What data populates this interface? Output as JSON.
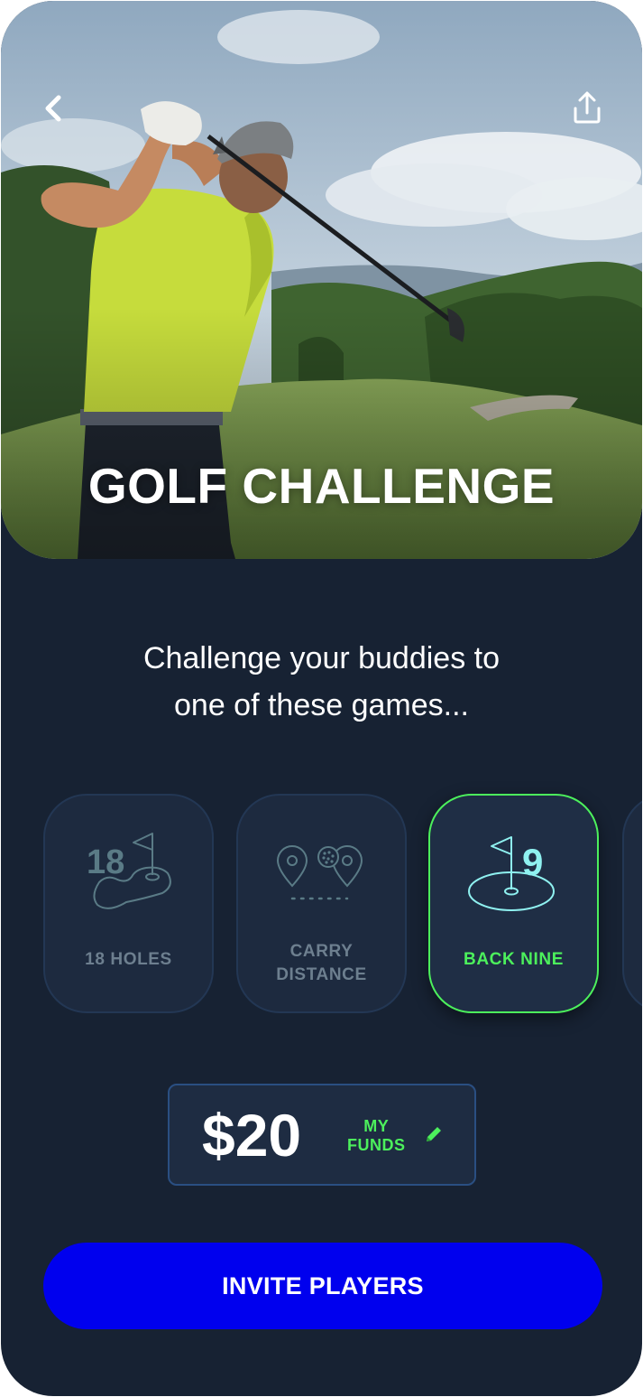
{
  "hero": {
    "title": "GOLF CHALLENGE",
    "back_icon": "chevron-left-icon",
    "share_icon": "share-upload-icon"
  },
  "intro": {
    "line1": "Challenge your buddies to",
    "line2": "one of these games..."
  },
  "games": [
    {
      "icon": "eighteen-holes-icon",
      "icon_text": "18",
      "label": "18 HOLES",
      "selected": false
    },
    {
      "icon": "carry-distance-icon",
      "label_line1": "CARRY",
      "label_line2": "DISTANCE",
      "selected": false
    },
    {
      "icon": "back-nine-icon",
      "icon_text": "9",
      "label": "BACK NINE",
      "selected": true
    }
  ],
  "funds": {
    "amount": "$20",
    "label_line1": "MY",
    "label_line2": "FUNDS",
    "edit_icon": "pencil-icon"
  },
  "cta": {
    "label": "INVITE PLAYERS"
  },
  "colors": {
    "background": "#172233",
    "card": "#1d2a3f",
    "accent_green": "#4cf05c",
    "primary_blue": "#0000ee",
    "muted_text": "#6d7f8f"
  }
}
